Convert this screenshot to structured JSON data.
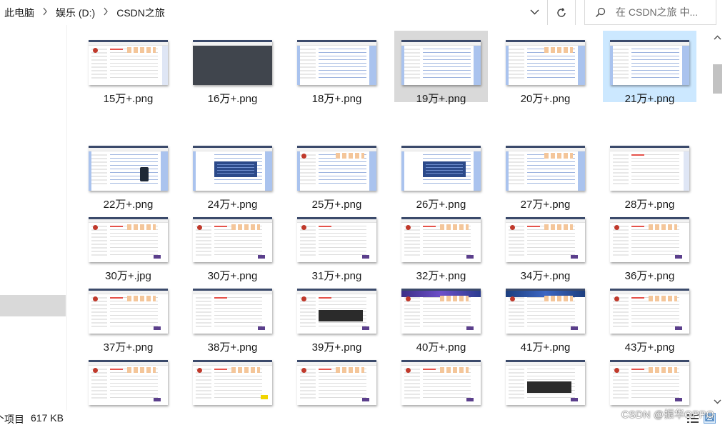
{
  "breadcrumb": {
    "items": [
      "此电脑",
      "娱乐 (D:)",
      "CSDN之旅"
    ]
  },
  "search": {
    "placeholder": "在 CSDN之旅 中..."
  },
  "icons": {
    "separator": "chevron-right-icon",
    "dropdown": "chevron-down-icon",
    "refresh": "refresh-icon",
    "search": "search-icon"
  },
  "files": [
    {
      "name": "15万+.png",
      "state": "normal"
    },
    {
      "name": "16万+.png",
      "state": "normal"
    },
    {
      "name": "18万+.png",
      "state": "normal"
    },
    {
      "name": "19万+.png",
      "state": "hover"
    },
    {
      "name": "20万+.png",
      "state": "normal"
    },
    {
      "name": "21万+.png",
      "state": "selected"
    },
    {
      "name": "22万+.png",
      "state": "normal"
    },
    {
      "name": "24万+.png",
      "state": "normal"
    },
    {
      "name": "25万+.png",
      "state": "normal"
    },
    {
      "name": "26万+.png",
      "state": "normal"
    },
    {
      "name": "27万+.png",
      "state": "normal"
    },
    {
      "name": "28万+.png",
      "state": "normal"
    },
    {
      "name": "30万+.jpg",
      "state": "normal"
    },
    {
      "name": "30万+.png",
      "state": "normal"
    },
    {
      "name": "31万+.png",
      "state": "normal"
    },
    {
      "name": "32万+.png",
      "state": "normal"
    },
    {
      "name": "34万+.png",
      "state": "normal"
    },
    {
      "name": "36万+.png",
      "state": "normal"
    },
    {
      "name": "37万+.png",
      "state": "normal"
    },
    {
      "name": "38万+.png",
      "state": "normal"
    },
    {
      "name": "39万+.png",
      "state": "normal"
    },
    {
      "name": "40万+.png",
      "state": "normal"
    },
    {
      "name": "41万+.png",
      "state": "normal"
    },
    {
      "name": "43万+.png",
      "state": "normal"
    },
    {
      "name": "",
      "state": "normal"
    },
    {
      "name": "",
      "state": "normal"
    },
    {
      "name": "",
      "state": "normal"
    },
    {
      "name": "",
      "state": "normal"
    },
    {
      "name": "",
      "state": "normal"
    },
    {
      "name": "",
      "state": "normal"
    }
  ],
  "status": {
    "count": "个项目",
    "size": "617 KB"
  },
  "watermark": "CSDN @振华OPPO",
  "colors": {
    "selected": "#cce8ff",
    "hover": "#d9d9d9",
    "nav_selected": "#d9d9d9"
  }
}
